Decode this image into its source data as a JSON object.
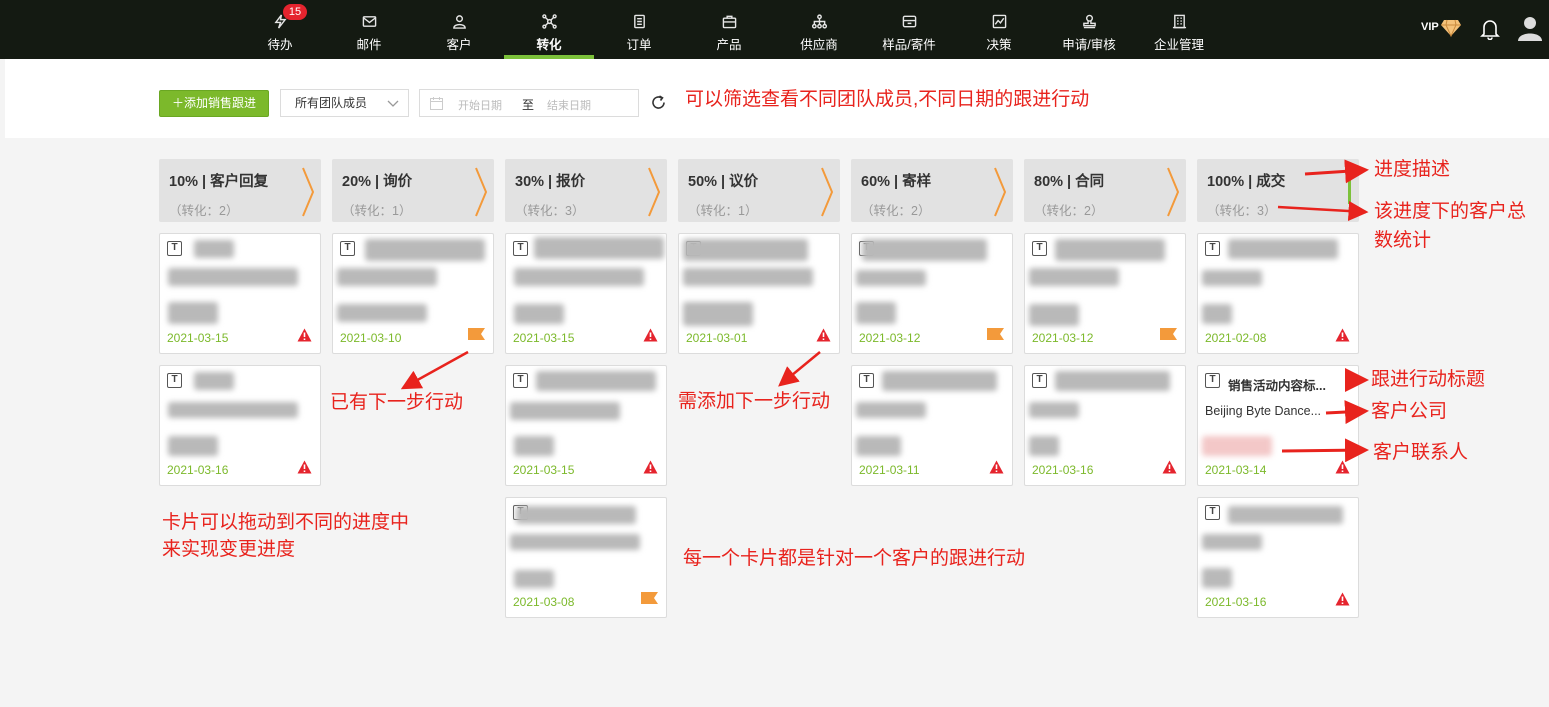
{
  "nav": {
    "items": [
      {
        "label": "待办",
        "icon": "lightning-icon",
        "badge": "15"
      },
      {
        "label": "邮件",
        "icon": "mail-icon"
      },
      {
        "label": "客户",
        "icon": "person-icon"
      },
      {
        "label": "转化",
        "icon": "network-icon",
        "active": true
      },
      {
        "label": "订单",
        "icon": "document-icon"
      },
      {
        "label": "产品",
        "icon": "box-icon"
      },
      {
        "label": "供应商",
        "icon": "hierarchy-icon"
      },
      {
        "label": "样品/寄件",
        "icon": "package-icon"
      },
      {
        "label": "决策",
        "icon": "chart-icon"
      },
      {
        "label": "申请/审核",
        "icon": "stamp-icon"
      },
      {
        "label": "企业管理",
        "icon": "building-icon"
      }
    ],
    "vip": "VIP",
    "accent": "#7cc13a"
  },
  "toolbar": {
    "add_label": "添加销售跟进",
    "member_select": "所有团队成员",
    "start_placeholder": "开始日期",
    "range_sep": "至",
    "end_placeholder": "结束日期"
  },
  "stages": [
    {
      "title": "10% | 客户回复",
      "count": "（转化：2）"
    },
    {
      "title": "20% | 询价",
      "count": "（转化：1）"
    },
    {
      "title": "30% | 报价",
      "count": "（转化：3）"
    },
    {
      "title": "50% | 议价",
      "count": "（转化：1）"
    },
    {
      "title": "60% | 寄样",
      "count": "（转化：2）"
    },
    {
      "title": "80% | 合同",
      "count": "（转化：2）"
    },
    {
      "title": "100% | 成交",
      "count": "（转化：3）"
    }
  ],
  "cards": [
    {
      "title": "",
      "company": "",
      "date": "2021-03-15",
      "flag": "warning"
    },
    {
      "title": "",
      "company": "",
      "date": "2021-03-16",
      "flag": "warning"
    },
    {
      "title": "",
      "company": "",
      "date": "2021-03-10",
      "flag": "next-step"
    },
    {
      "title": "",
      "company": "",
      "date": "2021-03-15",
      "flag": "warning"
    },
    {
      "title": "",
      "company": "",
      "date": "2021-03-15",
      "flag": "warning"
    },
    {
      "title": "",
      "company": "",
      "date": "2021-03-08",
      "flag": "next-step"
    },
    {
      "title": "",
      "company": "",
      "date": "2021-03-01",
      "flag": "warning"
    },
    {
      "title": "",
      "company": "",
      "date": "2021-03-12",
      "flag": "next-step"
    },
    {
      "title": "",
      "company": "",
      "date": "2021-03-11",
      "flag": "warning"
    },
    {
      "title": "",
      "company": "",
      "date": "2021-03-12",
      "flag": "next-step"
    },
    {
      "title": "",
      "company": "",
      "date": "2021-03-16",
      "flag": "warning"
    },
    {
      "title": "",
      "company": "",
      "date": "2021-02-08",
      "flag": "warning"
    },
    {
      "title": "销售活动内容标...",
      "company": "Beijing Byte Dance...",
      "date": "2021-03-14",
      "flag": "warning"
    },
    {
      "title": "",
      "company": "",
      "date": "2021-03-16",
      "flag": "warning"
    }
  ],
  "annotations": {
    "filter": "可以筛选查看不同团队成员,不同日期的跟进行动",
    "stage_desc": "进度描述",
    "stage_count_1": "该进度下的客户总",
    "stage_count_2": "数统计",
    "has_next": "已有下一步行动",
    "need_next": "需添加下一步行动",
    "action_title": "跟进行动标题",
    "company": "客户公司",
    "contact": "客户联系人",
    "drag_1": "卡片可以拖动到不同的进度中",
    "drag_2": "来实现变更进度",
    "each_card": "每一个卡片都是针对一个客户的跟进行动"
  },
  "colors": {
    "annotation": "#e8231d",
    "date": "#7cb92b",
    "warning": "#e5242e",
    "flag": "#f39a3b",
    "stage_arrow": "#f39a3b"
  }
}
